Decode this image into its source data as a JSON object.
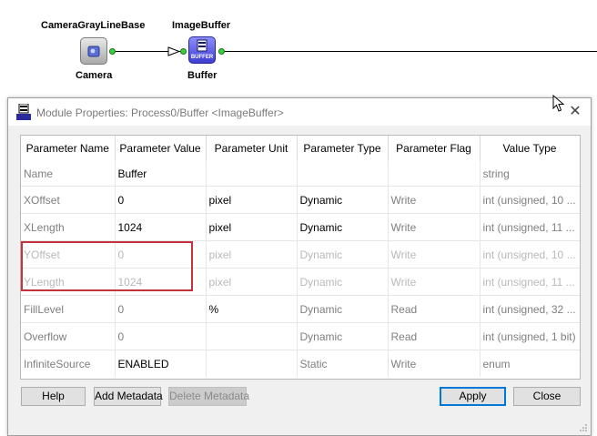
{
  "canvas": {
    "nodes": [
      {
        "title": "CameraGrayLineBase",
        "label": "Camera",
        "icon": "camera-module-icon"
      },
      {
        "title": "ImageBuffer",
        "label": "Buffer",
        "icon": "buffer-module-icon",
        "icon_text": "BUFFER"
      }
    ]
  },
  "dialog": {
    "title": "Module Properties: Process0/Buffer <ImageBuffer>",
    "title_icon": "buffer-module-icon",
    "close_icon": "close-icon",
    "columns": [
      "Parameter Name",
      "Parameter Value",
      "Parameter Unit",
      "Parameter Type",
      "Parameter Flag",
      "Value Type"
    ],
    "rows": [
      {
        "name": "Name",
        "value": "Buffer",
        "unit": "",
        "type": "",
        "flag": "",
        "vtype": "string",
        "state": "info"
      },
      {
        "name": "XOffset",
        "value": "0",
        "unit": "pixel",
        "type": "Dynamic",
        "flag": "Write",
        "vtype": "int (unsigned, 10 ...",
        "state": "normal"
      },
      {
        "name": "XLength",
        "value": "1024",
        "unit": "pixel",
        "type": "Dynamic",
        "flag": "Write",
        "vtype": "int (unsigned, 11 ...",
        "state": "normal"
      },
      {
        "name": "YOffset",
        "value": "0",
        "unit": "pixel",
        "type": "Dynamic",
        "flag": "Write",
        "vtype": "int (unsigned, 10 ...",
        "state": "disabled"
      },
      {
        "name": "YLength",
        "value": "1024",
        "unit": "pixel",
        "type": "Dynamic",
        "flag": "Write",
        "vtype": "int (unsigned, 11 ...",
        "state": "disabled"
      },
      {
        "name": "FillLevel",
        "value": "0",
        "unit": "%",
        "type": "Dynamic",
        "flag": "Read",
        "vtype": "int (unsigned, 32 ...",
        "state": "readonly"
      },
      {
        "name": "Overflow",
        "value": "0",
        "unit": "",
        "type": "Dynamic",
        "flag": "Read",
        "vtype": "int (unsigned, 1 bit)",
        "state": "readonly"
      },
      {
        "name": "InfiniteSource",
        "value": "ENABLED",
        "unit": "",
        "type": "Static",
        "flag": "Write",
        "vtype": "enum",
        "state": "static"
      }
    ],
    "buttons": {
      "help": "Help",
      "add_metadata": "Add Metadata",
      "delete_metadata": "Delete Metadata",
      "apply": "Apply",
      "close": "Close"
    }
  },
  "colors": {
    "highlight_border": "#c3333b",
    "default_button_border": "#0078d7",
    "port": "#39d339",
    "buffer_icon": "#4b4bff"
  }
}
